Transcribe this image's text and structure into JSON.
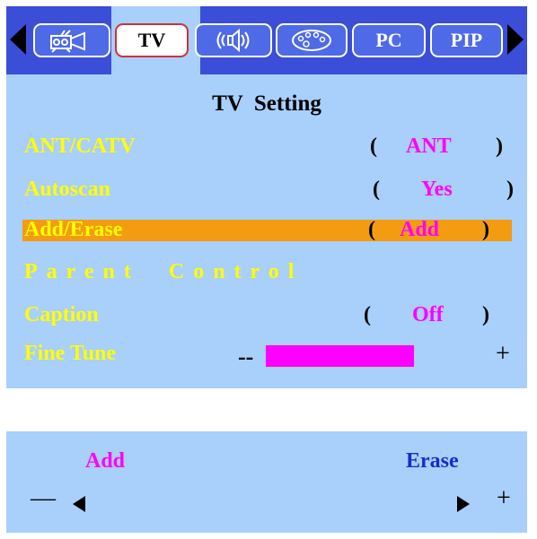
{
  "tabs": {
    "picture_icon": "tv-camera-icon",
    "tv": "TV",
    "audio_icon": "speaker-icon",
    "feature_icon": "palette-icon",
    "pc": "PC",
    "pip": "PIP",
    "selected": "TV"
  },
  "menu": {
    "title": "TV  Setting",
    "rows": [
      {
        "label": "ANT/CATV",
        "value": "ANT"
      },
      {
        "label": "Autoscan",
        "value": "Yes"
      },
      {
        "label": "Add/Erase",
        "value": "Add",
        "highlighted": true
      },
      {
        "label": "Parent  Control"
      },
      {
        "label": "Caption",
        "value": "Off"
      },
      {
        "label": "Fine Tune",
        "minus": "--",
        "plus": "+",
        "level_fraction": 0.55
      }
    ],
    "paren_open": "(",
    "paren_close": ")"
  },
  "footer": {
    "left_label": "Add",
    "right_label": "Erase",
    "minus": "—",
    "plus": "+"
  },
  "colors": {
    "tab_bar": "#3a4ed8",
    "panel": "#a9cffb",
    "label": "#ffff00",
    "value": "#ff00ff",
    "highlight": "#f39c12",
    "erase": "#1a2ccc"
  }
}
